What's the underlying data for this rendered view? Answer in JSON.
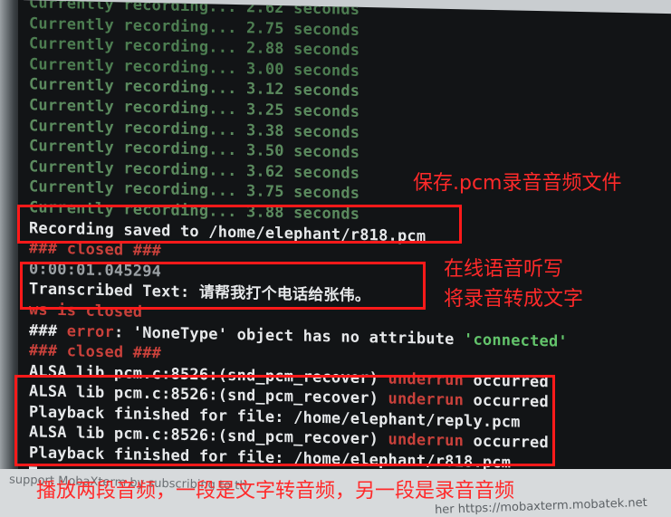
{
  "terminal": {
    "lines": [
      {
        "text": "Currently recording... 2.62 seconds"
      },
      {
        "text": "Currently recording... 2.75 seconds"
      },
      {
        "text": "Currently recording... 2.88 seconds"
      },
      {
        "text": "Currently recording... 3.00 seconds"
      },
      {
        "text": "Currently recording... 3.12 seconds"
      },
      {
        "text": "Currently recording... 3.25 seconds"
      },
      {
        "text": "Currently recording... 3.38 seconds"
      },
      {
        "text": "Currently recording... 3.50 seconds"
      },
      {
        "text": "Currently recording... 3.62 seconds"
      },
      {
        "text": "Currently recording... 3.75 seconds"
      },
      {
        "text": "Currently recording... 3.88 seconds"
      },
      {
        "text": "Recording saved to /home/elephant/r818.pcm"
      },
      {
        "text": "### closed ###"
      },
      {
        "text": "0:00:01.045294"
      },
      {
        "text": "Transcribed Text: 请帮我打个电话给张伟。"
      },
      {
        "text": "ws is closed"
      },
      {
        "hash": "###",
        "error_word": "error",
        "rest": ": 'NoneType' object has no attribute ",
        "quoted": "'connected'"
      },
      {
        "text": "### closed ###"
      },
      {
        "prefix": "ALSA lib pcm.c:8526:(snd_pcm_recover) ",
        "under": "underrun",
        "suffix": " occurred"
      },
      {
        "prefix": "ALSA lib pcm.c:8526:(snd_pcm_recover) ",
        "under": "underrun",
        "suffix": " occurred"
      },
      {
        "text": "Playback finished for file: /home/elephant/reply.pcm"
      },
      {
        "prefix": "ALSA lib pcm.c:8526:(snd_pcm_recover) ",
        "under": "underrun",
        "suffix": " occurred"
      },
      {
        "text": "Playback finished for file: /home/elephant/r818.pcm"
      }
    ]
  },
  "footer": {
    "text": "support MobaXterm by subscribing to th",
    "url": "her https://mobaxterm.mobatek.net"
  },
  "annotations": {
    "save_pcm": "保存.pcm录音音频文件",
    "asr_line1": "在线语音听写",
    "asr_line2": "将录音转成文字",
    "playback": "播放两段音频，一段是文字转音频，另一段是录音音频"
  },
  "colors": {
    "annotation": "#ff2a2a",
    "terminal_bg": "#121416",
    "error": "#c9413b",
    "highlight_green": "#63c46b"
  }
}
